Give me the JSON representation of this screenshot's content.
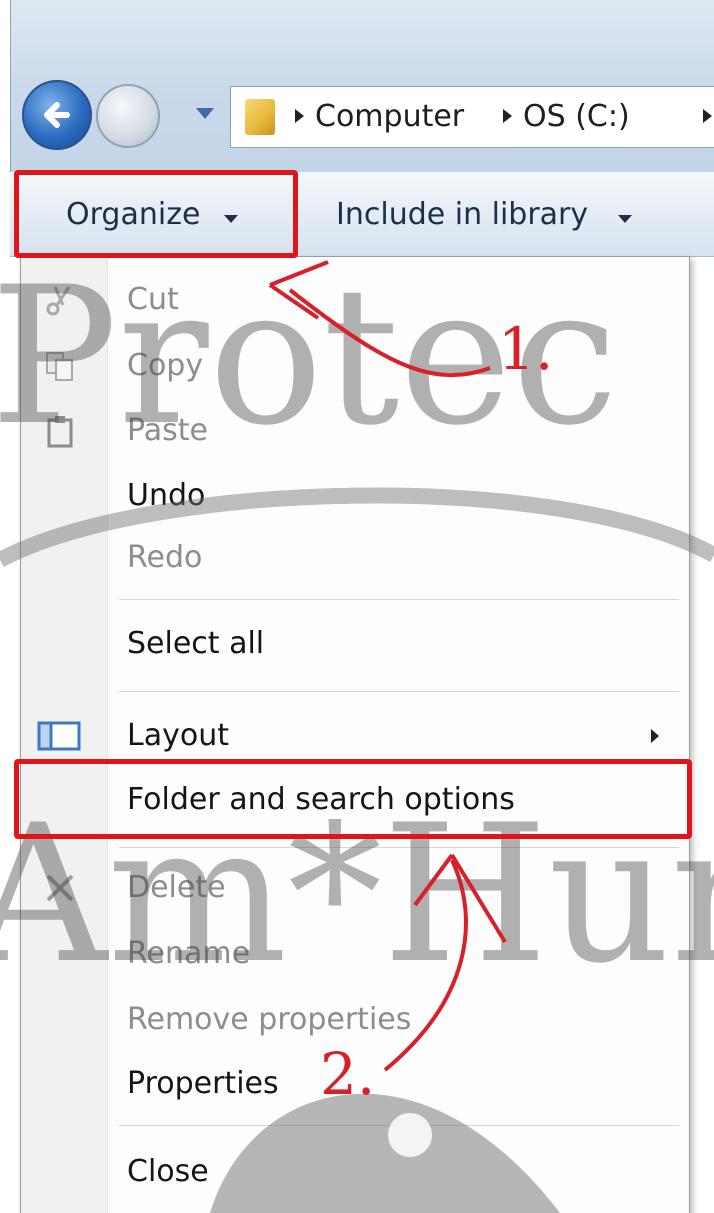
{
  "address_bar": {
    "breadcrumbs": [
      "Computer",
      "OS (C:)"
    ]
  },
  "command_bar": {
    "organize_label": "Organize",
    "include_label": "Include in library"
  },
  "menu": {
    "items": [
      {
        "label": "Cut",
        "enabled": false,
        "icon": "scissors-icon"
      },
      {
        "label": "Copy",
        "enabled": false,
        "icon": "copy-icon"
      },
      {
        "label": "Paste",
        "enabled": false,
        "icon": "clipboard-icon"
      },
      {
        "label": "Undo",
        "enabled": true
      },
      {
        "label": "Redo",
        "enabled": false
      },
      {
        "label": "Select all",
        "enabled": true
      },
      {
        "label": "Layout",
        "enabled": true,
        "icon": "layout-icon",
        "submenu": true
      },
      {
        "label": "Folder and search options",
        "enabled": true,
        "highlighted": true
      },
      {
        "label": "Delete",
        "enabled": false,
        "icon": "delete-x-icon"
      },
      {
        "label": "Rename",
        "enabled": false
      },
      {
        "label": "Remove properties",
        "enabled": false
      },
      {
        "label": "Properties",
        "enabled": true
      },
      {
        "label": "Close",
        "enabled": true
      }
    ]
  },
  "annotations": {
    "step1": "1.",
    "step2": "2.",
    "color": "#e0151a"
  },
  "watermark": {
    "line1": "Protec",
    "line2": "Am*Humm"
  }
}
